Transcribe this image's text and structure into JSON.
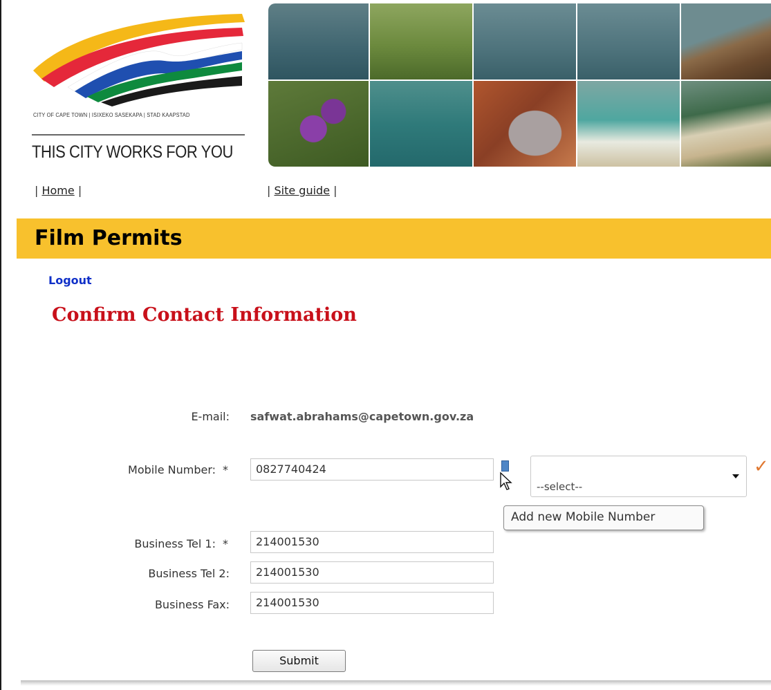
{
  "header": {
    "city_names": "CITY OF CAPE TOWN | ISIXEKO SASEKAPA | STAD KAAPSTAD",
    "tagline": "THIS CITY WORKS FOR YOU"
  },
  "nav": {
    "home": "Home",
    "site_guide": "Site guide"
  },
  "banner": {
    "title": "Film Permits"
  },
  "logout": "Logout",
  "page_title": "Confirm Contact Information",
  "form": {
    "email_label": "E-mail:",
    "email_value": "safwat.abrahams@capetown.gov.za",
    "mobile_label": "Mobile Number:",
    "mobile_value": "0827740424",
    "mobile_select": "--select--",
    "add_tooltip": "Add new Mobile Number",
    "tel1_label": "Business Tel 1:",
    "tel1_value": "214001530",
    "tel2_label": "Business Tel 2:",
    "tel2_value": "214001530",
    "fax_label": "Business Fax:",
    "fax_value": "214001530",
    "required_mark": "*",
    "submit_label": "Submit"
  },
  "colors": {
    "banner": "#f8c12d",
    "title_red": "#c8101a",
    "link_blue": "#1030c8",
    "check_orange": "#e07830"
  },
  "icons": {
    "add": "add-mobile-icon",
    "check": "check-icon",
    "cursor": "mouse-pointer-icon",
    "dropdown": "chevron-down-icon"
  }
}
